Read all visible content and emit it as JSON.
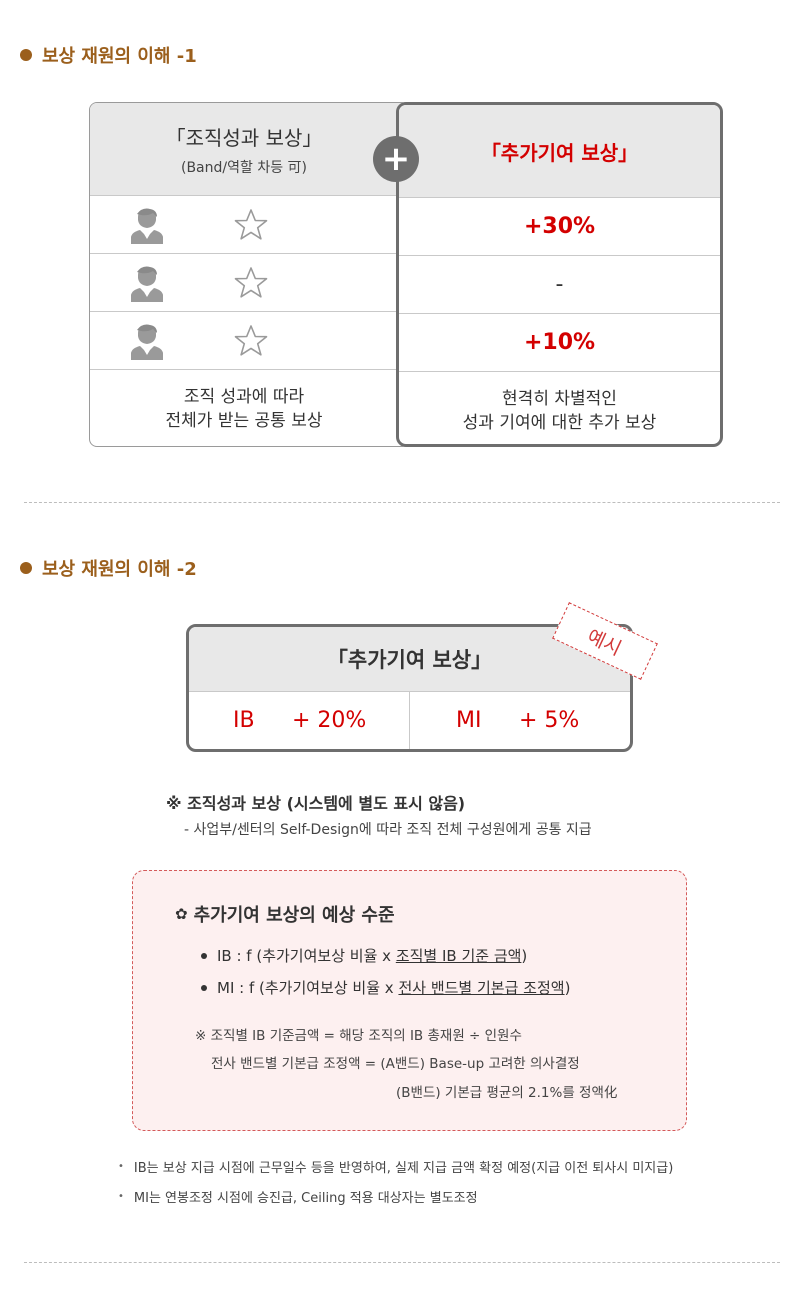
{
  "section1": {
    "title": "보상 재원의 이해 -1",
    "left": {
      "header_main": "「조직성과 보상」",
      "header_sub": "(Band/역할 차등 可)",
      "footer_line1": "조직 성과에 따라",
      "footer_line2": "전체가 받는 공통 보상"
    },
    "plus_symbol": "+",
    "right": {
      "header": "「추가기여 보상」",
      "rows": [
        "+30%",
        "-",
        "+10%"
      ],
      "footer_line1": "현격히 차별적인",
      "footer_line2": "성과 기여에 대한 추가 보상"
    },
    "icons": [
      "person-icon",
      "star-outline-icon"
    ]
  },
  "section2": {
    "title": "보상 재원의 이해 -2",
    "box_header": "「추가기여 보상」",
    "stamp": "예시",
    "ib_label": "IB",
    "ib_value": "+ 20%",
    "mi_label": "MI",
    "mi_value": "+ 5%",
    "note_title": "※ 조직성과 보상 (시스템에 별도 표시 않음)",
    "note_sub": "- 사업부/센터의 Self-Design에 따라 조직 전체 구성원에게 공통 지급",
    "expected": {
      "title": "추가기여 보상의 예상 수준",
      "ib_prefix": "IB : f (추가기여보상 비율 x ",
      "ib_underline": "조직별 IB 기준 금액",
      "ib_suffix": ")",
      "mi_prefix": "MI : f (추가기여보상 비율 x ",
      "mi_underline": "전사 밴드별 기본급 조정액",
      "mi_suffix": ")",
      "note1": "※ 조직별 IB 기준금액 = 해당 조직의 IB 총재원 ÷ 인원수",
      "note2": "전사 밴드별 기본급 조정액 = (A밴드) Base-up 고려한 의사결정",
      "note3": "(B밴드) 기본급 평균의 2.1%를 정액化"
    },
    "bottom_notes": [
      "IB는 보상 지급 시점에 근무일수 등을 반영하여, 실제 지급 금액 확정 예정(지급 이전 퇴사시 미지급)",
      "MI는 연봉조정 시점에 승진급, Ceiling 적용 대상자는 별도조정"
    ]
  },
  "colors": {
    "accent_brown": "#9b5f1c",
    "accent_red": "#d30000",
    "box_border": "#6e6e6e",
    "header_gray": "#e8e8e8",
    "pink_bg": "#fdf0f0"
  }
}
